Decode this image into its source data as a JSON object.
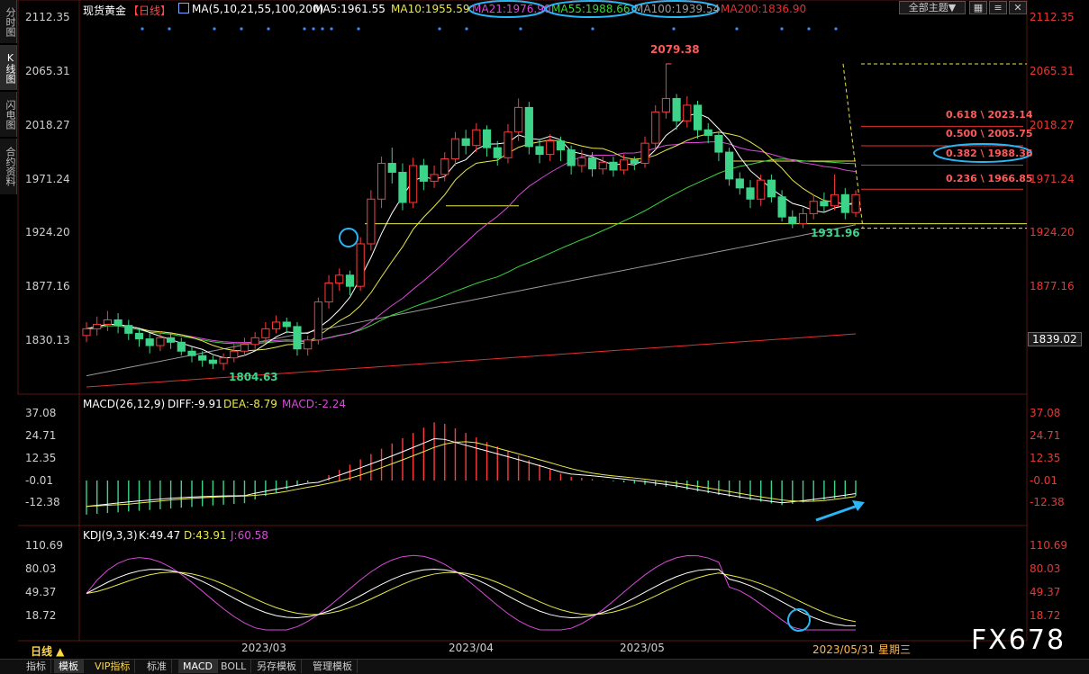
{
  "side_tabs": [
    {
      "label": "分时图"
    },
    {
      "label": "K线图"
    },
    {
      "label": "闪电图"
    },
    {
      "label": "合约资料"
    }
  ],
  "header": {
    "title": "现货黄金",
    "period": "【日线】",
    "ma_main": "MA(5,10,21,55,100,200)",
    "ma5": "MA5:1961.55",
    "ma10": "MA10:1955.59",
    "ma21": "MA21:1976.90",
    "ma55": "MA55:1988.66",
    "ma100": "MA100:1939.54",
    "ma200": "MA200:1836.90",
    "theme_select": "全部主题▼",
    "colors": {
      "ma5": "#ffffff",
      "ma10": "#e8e84a",
      "ma21": "#d94ad9",
      "ma55": "#3dd43d",
      "ma100": "#9a9a9a",
      "ma200": "#e53030"
    }
  },
  "main_axis": {
    "left_ticks": [
      "2112.35",
      "2065.31",
      "2018.27",
      "1971.24",
      "1924.20",
      "1877.16",
      "1830.13"
    ],
    "right_ticks": [
      "2112.35",
      "2065.31",
      "2018.27",
      "1971.24",
      "1924.20",
      "1877.16"
    ],
    "current_price": "1839.02"
  },
  "price_annotations": {
    "high": "2079.38",
    "low": "1804.63",
    "recent_low": "1931.96"
  },
  "fibonacci": [
    {
      "label": "0.618 \\ 2023.14",
      "value": 2023.14
    },
    {
      "label": "0.500 \\ 2005.75",
      "value": 2005.75
    },
    {
      "label": "0.382 \\ 1988.36",
      "value": 1988.36
    },
    {
      "label": "0.236 \\ 1966.85",
      "value": 1966.85
    }
  ],
  "macd": {
    "title": "MACD(26,12,9)",
    "diff": "DIFF:-9.91",
    "dea": "DEA:-8.79",
    "macd": "MACD:-2.24",
    "ticks": [
      "37.08",
      "24.71",
      "12.35",
      "-0.01",
      "-12.38"
    ]
  },
  "kdj": {
    "title": "KDJ(9,3,3)",
    "k": "K:49.47",
    "d": "D:43.91",
    "j": "J:60.58",
    "ticks": [
      "110.69",
      "80.03",
      "49.37",
      "18.72"
    ]
  },
  "x_axis": {
    "labels": [
      "2023/03",
      "2023/04",
      "2023/05"
    ],
    "cursor_date": "2023/05/31 星期三"
  },
  "period_button": "日线 ▲",
  "bottom_tabs": [
    "指标",
    "模板",
    "VIP指标",
    "标准",
    "MACD",
    "BOLL",
    "另存模板",
    "管理模板"
  ],
  "watermark": "FX678",
  "chart_data": {
    "type": "candlestick",
    "candles": [
      [
        1836,
        1842,
        1848,
        1830
      ],
      [
        1842,
        1846,
        1853,
        1836
      ],
      [
        1846,
        1850,
        1858,
        1840
      ],
      [
        1850,
        1845,
        1856,
        1838
      ],
      [
        1845,
        1838,
        1850,
        1832
      ],
      [
        1838,
        1833,
        1842,
        1826
      ],
      [
        1833,
        1827,
        1838,
        1820
      ],
      [
        1827,
        1834,
        1840,
        1822
      ],
      [
        1834,
        1830,
        1839,
        1824
      ],
      [
        1830,
        1822,
        1834,
        1818
      ],
      [
        1822,
        1818,
        1826,
        1812
      ],
      [
        1818,
        1814,
        1822,
        1808
      ],
      [
        1814,
        1811,
        1818,
        1806
      ],
      [
        1811,
        1816,
        1820,
        1805
      ],
      [
        1816,
        1822,
        1828,
        1812
      ],
      [
        1822,
        1828,
        1834,
        1818
      ],
      [
        1828,
        1834,
        1839,
        1824
      ],
      [
        1834,
        1842,
        1848,
        1830
      ],
      [
        1842,
        1848,
        1854,
        1838
      ],
      [
        1848,
        1844,
        1852,
        1838
      ],
      [
        1844,
        1824,
        1848,
        1818
      ],
      [
        1824,
        1832,
        1836,
        1818
      ],
      [
        1832,
        1866,
        1870,
        1828
      ],
      [
        1866,
        1883,
        1890,
        1860
      ],
      [
        1883,
        1890,
        1896,
        1876
      ],
      [
        1890,
        1880,
        1894,
        1872
      ],
      [
        1880,
        1918,
        1924,
        1876
      ],
      [
        1918,
        1958,
        1966,
        1912
      ],
      [
        1958,
        1990,
        1996,
        1950
      ],
      [
        1990,
        1982,
        2004,
        1972
      ],
      [
        1982,
        1955,
        1990,
        1948
      ],
      [
        1955,
        1988,
        1995,
        1950
      ],
      [
        1988,
        1974,
        1994,
        1966
      ],
      [
        1974,
        1980,
        1988,
        1968
      ],
      [
        1980,
        1994,
        2000,
        1974
      ],
      [
        1994,
        2012,
        2018,
        1988
      ],
      [
        2012,
        2006,
        2020,
        1998
      ],
      [
        2006,
        2020,
        2026,
        2000
      ],
      [
        2020,
        2004,
        2024,
        1996
      ],
      [
        2004,
        1995,
        2010,
        1988
      ],
      [
        1995,
        2018,
        2025,
        1990
      ],
      [
        2018,
        2040,
        2048,
        2010
      ],
      [
        2040,
        2005,
        2045,
        1998
      ],
      [
        2005,
        1998,
        2012,
        1990
      ],
      [
        1998,
        2010,
        2016,
        1992
      ],
      [
        2010,
        2002,
        2014,
        1992
      ],
      [
        2002,
        1988,
        2006,
        1980
      ],
      [
        1988,
        1995,
        2002,
        1982
      ],
      [
        1995,
        1985,
        2000,
        1978
      ],
      [
        1985,
        1991,
        1996,
        1980
      ],
      [
        1991,
        1984,
        1996,
        1978
      ],
      [
        1984,
        1993,
        1998,
        1980
      ],
      [
        1993,
        1990,
        1996,
        1984
      ],
      [
        1990,
        2008,
        2014,
        1986
      ],
      [
        2008,
        2036,
        2042,
        2002
      ],
      [
        2036,
        2048,
        2079,
        2030
      ],
      [
        2048,
        2028,
        2052,
        2020
      ],
      [
        2028,
        2042,
        2050,
        2022
      ],
      [
        2042,
        2020,
        2046,
        2012
      ],
      [
        2020,
        2015,
        2026,
        2008
      ],
      [
        2015,
        2000,
        2018,
        1992
      ],
      [
        2000,
        1976,
        2004,
        1970
      ],
      [
        1976,
        1968,
        1982,
        1962
      ],
      [
        1968,
        1958,
        1975,
        1950
      ],
      [
        1958,
        1975,
        1980,
        1952
      ],
      [
        1975,
        1960,
        1980,
        1955
      ],
      [
        1960,
        1942,
        1966,
        1938
      ],
      [
        1942,
        1936,
        1948,
        1932
      ],
      [
        1936,
        1945,
        1950,
        1932
      ],
      [
        1945,
        1956,
        1962,
        1940
      ],
      [
        1956,
        1952,
        1964,
        1946
      ],
      [
        1952,
        1962,
        1980,
        1948
      ],
      [
        1962,
        1946,
        1968,
        1940
      ],
      [
        1946,
        1962,
        1966,
        1942
      ]
    ]
  }
}
